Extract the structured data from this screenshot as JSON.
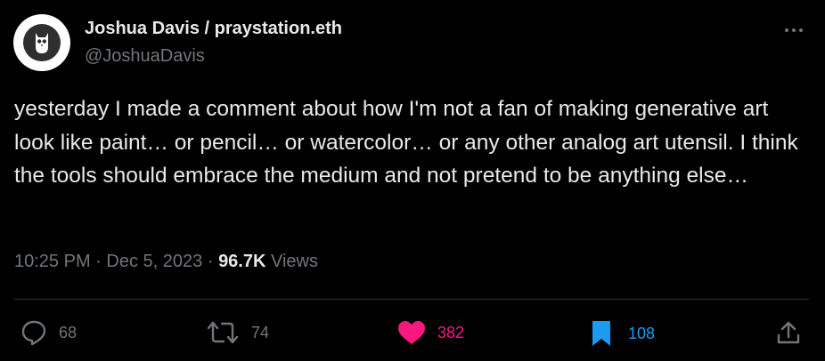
{
  "author": {
    "display_name": "Joshua Davis / praystation.eth",
    "handle": "@JoshuaDavis"
  },
  "tweet": {
    "text": "yesterday I made a comment about how I'm not a fan of making generative art look like paint… or pencil… or watercolor… or any other analog art utensil. I think the tools should embrace the medium and not pretend to be anything else…",
    "time": "10:25 PM",
    "date": "Dec 5, 2023",
    "separator": "·",
    "views_count": "96.7K",
    "views_label": "Views"
  },
  "actions": {
    "replies": "68",
    "retweets": "74",
    "likes": "382",
    "bookmarks": "108"
  },
  "colors": {
    "background": "#000000",
    "text_primary": "#e7e9ea",
    "text_secondary": "#71767b",
    "like_active": "#f91880",
    "bookmark_active": "#1d9bf0",
    "divider": "#2f3336"
  },
  "icons": {
    "more": "more-icon",
    "reply": "reply-icon",
    "retweet": "retweet-icon",
    "like": "heart-icon",
    "bookmark": "bookmark-icon",
    "share": "share-icon"
  }
}
